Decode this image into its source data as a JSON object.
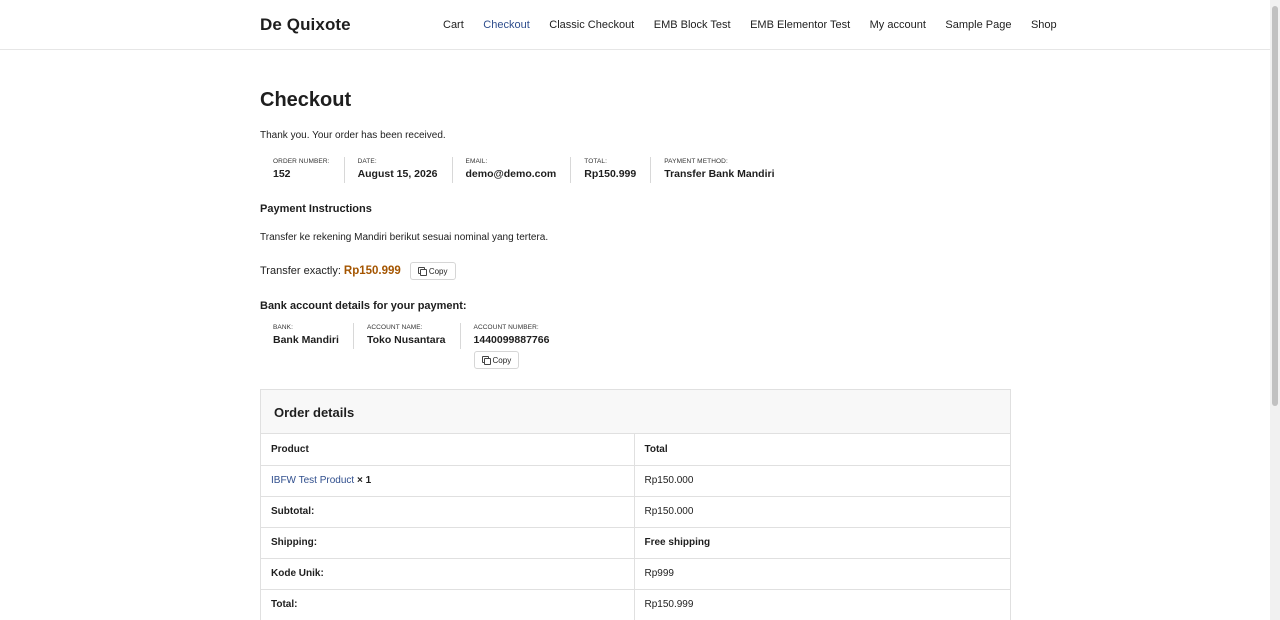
{
  "header": {
    "site_title": "De Quixote",
    "nav": [
      {
        "label": "Cart",
        "active": false
      },
      {
        "label": "Checkout",
        "active": true
      },
      {
        "label": "Classic Checkout",
        "active": false
      },
      {
        "label": "EMB Block Test",
        "active": false
      },
      {
        "label": "EMB Elementor Test",
        "active": false
      },
      {
        "label": "My account",
        "active": false
      },
      {
        "label": "Sample Page",
        "active": false
      },
      {
        "label": "Shop",
        "active": false
      }
    ]
  },
  "page": {
    "title": "Checkout",
    "thanks": "Thank you. Your order has been received."
  },
  "overview": {
    "order_number_label": "Order number:",
    "order_number": "152",
    "date_label": "Date:",
    "date": "August 15, 2026",
    "email_label": "Email:",
    "email": "demo@demo.com",
    "total_label": "Total:",
    "total": "Rp150.999",
    "payment_method_label": "Payment method:",
    "payment_method": "Transfer Bank Mandiri"
  },
  "instructions": {
    "heading": "Payment Instructions",
    "text": "Transfer ke rekening Mandiri berikut sesuai nominal yang tertera.",
    "transfer_label": "Transfer exactly:",
    "transfer_amount": "Rp150.999",
    "copy_label": "Copy",
    "accent_color": "#a45500"
  },
  "bank": {
    "heading": "Bank account details for your payment:",
    "bank_label": "Bank:",
    "bank_name": "Bank Mandiri",
    "account_name_label": "Account name:",
    "account_name": "Toko Nusantara",
    "account_number_label": "Account number:",
    "account_number": "1440099887766",
    "copy_label": "Copy"
  },
  "order_details": {
    "heading": "Order details",
    "col_product": "Product",
    "col_total": "Total",
    "product_name": "IBFW Test Product",
    "product_qty": "× 1",
    "product_total": "Rp150.000",
    "rows": [
      {
        "label": "Subtotal:",
        "value": "Rp150.000"
      },
      {
        "label": "Shipping:",
        "value": "Free shipping"
      },
      {
        "label": "Kode Unik:",
        "value": "Rp999"
      },
      {
        "label": "Total:",
        "value": "Rp150.999"
      }
    ]
  }
}
